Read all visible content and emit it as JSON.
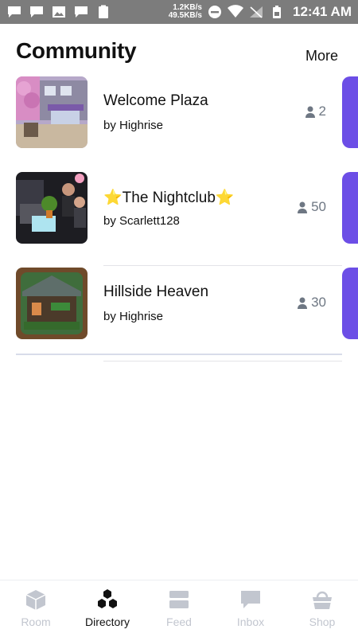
{
  "status_bar": {
    "net_up": "1.2KB/s",
    "net_down": "49.5KB/s",
    "time": "12:41 AM"
  },
  "header": {
    "title": "Community",
    "more_label": "More"
  },
  "rooms": [
    {
      "name": "Welcome Plaza",
      "owner": "by Highrise",
      "count": "2"
    },
    {
      "name": "⭐The Nightclub⭐",
      "owner": "by Scarlett128",
      "count": "50"
    },
    {
      "name": "Hillside Heaven",
      "owner": "by Highrise",
      "count": "30"
    }
  ],
  "tabs": [
    {
      "label": "Room",
      "icon": "room-cube-icon",
      "active": false
    },
    {
      "label": "Directory",
      "icon": "directory-hex-icon",
      "active": true
    },
    {
      "label": "Feed",
      "icon": "feed-icon",
      "active": false
    },
    {
      "label": "Inbox",
      "icon": "inbox-chat-icon",
      "active": false
    },
    {
      "label": "Shop",
      "icon": "shop-basket-icon",
      "active": false
    }
  ],
  "colors": {
    "accent": "#6c4ee6",
    "status_bar": "#7c7c7c",
    "inactive_tab": "#c2c6cf",
    "count_text": "#6e7783"
  }
}
